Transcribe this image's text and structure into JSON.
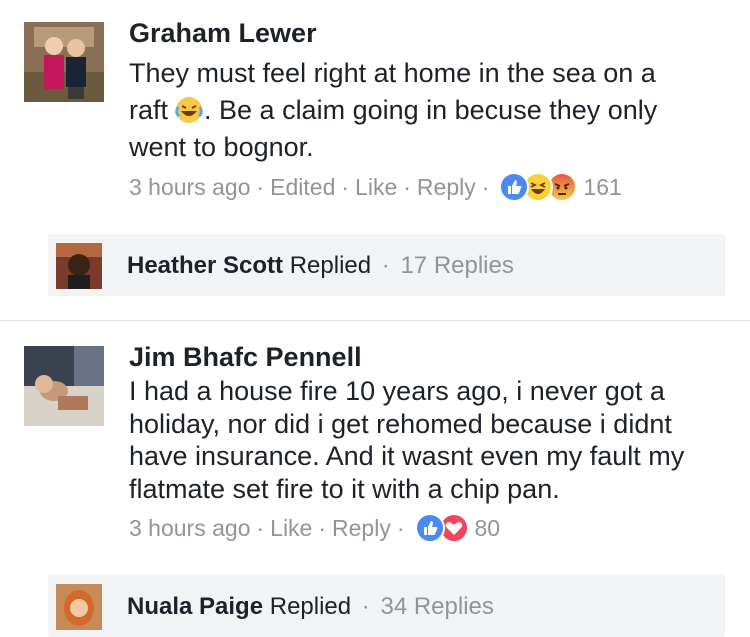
{
  "comments": [
    {
      "author": "Graham Lewer",
      "lines": [
        "They must feel right at home in the sea on a",
        ". Be a claim going in becuse they only",
        "went to bognor."
      ],
      "inline_text_before_emoji": "raft",
      "inline_emoji": "laughing-tears-emoji",
      "meta": {
        "time": "3 hours ago",
        "edited": "Edited",
        "like": "Like",
        "reply": "Reply"
      },
      "reactions": [
        "like-reaction",
        "haha-reaction",
        "angry-reaction"
      ],
      "reaction_count": "161",
      "reply_summary": {
        "name": "Heather Scott",
        "verb": "Replied",
        "sep": "·",
        "count": "17 Replies"
      }
    },
    {
      "author": "Jim Bhafc Pennell",
      "lines": [
        "I had a house fire 10 years ago, i never got a",
        "holiday, nor did i get rehomed because i didnt",
        "have insurance. And it wasnt even my fault my",
        "flatmate set fire to it with a chip pan."
      ],
      "meta": {
        "time": "3 hours ago",
        "like": "Like",
        "reply": "Reply"
      },
      "reactions": [
        "like-reaction",
        "love-reaction"
      ],
      "reaction_count": "80",
      "reply_summary": {
        "name": "Nuala Paige",
        "verb": "Replied",
        "sep": "·",
        "count": "34 Replies"
      }
    }
  ],
  "colors": {
    "text": "#1d2129",
    "meta": "#90949c",
    "reply_bg": "#f2f3f5",
    "like_blue": "#4a8af4",
    "love_red": "#f0455b",
    "haha_yellow": "#f7d23a"
  },
  "separator": "·"
}
